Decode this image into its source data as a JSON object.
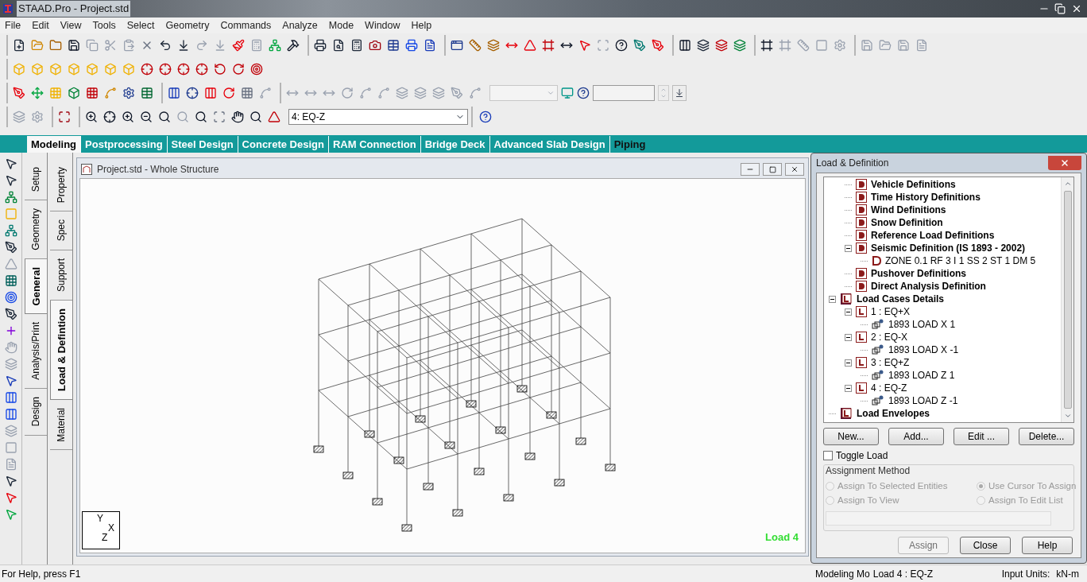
{
  "window": {
    "title": "STAAD.Pro - Project.std"
  },
  "menu": [
    "File",
    "Edit",
    "View",
    "Tools",
    "Select",
    "Geometry",
    "Commands",
    "Analyze",
    "Mode",
    "Window",
    "Help"
  ],
  "toolbar": {
    "load_dropdown": {
      "value": "4: EQ-Z"
    }
  },
  "mode_tabs": [
    {
      "label": "Modeling",
      "selected": true
    },
    {
      "label": "Postprocessing",
      "selected": false
    },
    {
      "label": "Steel Design",
      "selected": false
    },
    {
      "label": "Concrete Design",
      "selected": false
    },
    {
      "label": "RAM Connection",
      "selected": false
    },
    {
      "label": "Bridge Deck",
      "selected": false
    },
    {
      "label": "Advanced Slab Design",
      "selected": false
    },
    {
      "label": "Piping",
      "selected": false
    }
  ],
  "side_tabs": {
    "column_1": [
      {
        "label": "Setup",
        "selected": false
      },
      {
        "label": "Geometry",
        "selected": false
      },
      {
        "label": "General",
        "selected": true
      },
      {
        "label": "Analysis/Print",
        "selected": false
      },
      {
        "label": "Design",
        "selected": false
      }
    ],
    "column_2": [
      {
        "label": "Property",
        "selected": false
      },
      {
        "label": "Spec",
        "selected": false
      },
      {
        "label": "Support",
        "selected": false
      },
      {
        "label": "Load & Defintion",
        "selected": true
      },
      {
        "label": "Material",
        "selected": false
      }
    ]
  },
  "viewport": {
    "title": "Project.std - Whole Structure",
    "axis_labels": [
      "Y",
      "X",
      "Z"
    ],
    "load_label": "Load 4"
  },
  "dialog": {
    "title": "Load & Definition",
    "definitions": [
      {
        "label": "Vehicle Definitions",
        "kind": "definition"
      },
      {
        "label": "Time History Definitions",
        "kind": "definition"
      },
      {
        "label": "Wind Definitions",
        "kind": "definition"
      },
      {
        "label": "Snow Definition",
        "kind": "definition"
      },
      {
        "label": "Reference Load Definitions",
        "kind": "definition"
      },
      {
        "label": "Seismic Definition (IS 1893 - 2002)",
        "kind": "definition",
        "expanded": true,
        "children": [
          {
            "label": "ZONE 0.1 RF 3 I 1 SS 2 ST 1 DM 5",
            "kind": "value"
          }
        ]
      },
      {
        "label": "Pushover Definitions",
        "kind": "definition"
      },
      {
        "label": "Direct Analysis Definition",
        "kind": "definition"
      }
    ],
    "tree": [
      {
        "label": "Load Cases Details",
        "kind": "group",
        "expanded": true,
        "children": [
          {
            "label": "1 : EQ+X",
            "kind": "case",
            "expanded": true,
            "children": [
              {
                "label": "1893 LOAD X 1",
                "kind": "load"
              }
            ]
          },
          {
            "label": "2 : EQ-X",
            "kind": "case",
            "expanded": true,
            "children": [
              {
                "label": "1893 LOAD X -1",
                "kind": "load"
              }
            ]
          },
          {
            "label": "3 : EQ+Z",
            "kind": "case",
            "expanded": true,
            "children": [
              {
                "label": "1893 LOAD Z 1",
                "kind": "load"
              }
            ]
          },
          {
            "label": "4 : EQ-Z",
            "kind": "case",
            "expanded": true,
            "children": [
              {
                "label": "1893 LOAD Z -1",
                "kind": "load"
              }
            ]
          }
        ]
      },
      {
        "label": "Load Envelopes",
        "kind": "group"
      }
    ],
    "buttons": [
      "New...",
      "Add...",
      "Edit ...",
      "Delete..."
    ],
    "toggle_load": {
      "label": "Toggle Load",
      "checked": false
    },
    "assignment_method": {
      "title": "Assignment Method",
      "disabled": true,
      "options": [
        {
          "label": "Assign To Selected Entities",
          "selected": false
        },
        {
          "label": "Use Cursor To Assign",
          "selected": true
        },
        {
          "label": "Assign To View",
          "selected": false
        },
        {
          "label": "Assign To Edit List",
          "selected": false
        }
      ]
    },
    "actions": [
      {
        "label": "Assign",
        "disabled": true
      },
      {
        "label": "Close",
        "disabled": false
      },
      {
        "label": "Help",
        "disabled": false
      }
    ]
  },
  "status_bar": {
    "help": "For Help, press F1",
    "mode": "Modeling Mo",
    "load": "Load 4 : EQ-Z",
    "units_label": "Input Units:",
    "units": "kN-m"
  }
}
